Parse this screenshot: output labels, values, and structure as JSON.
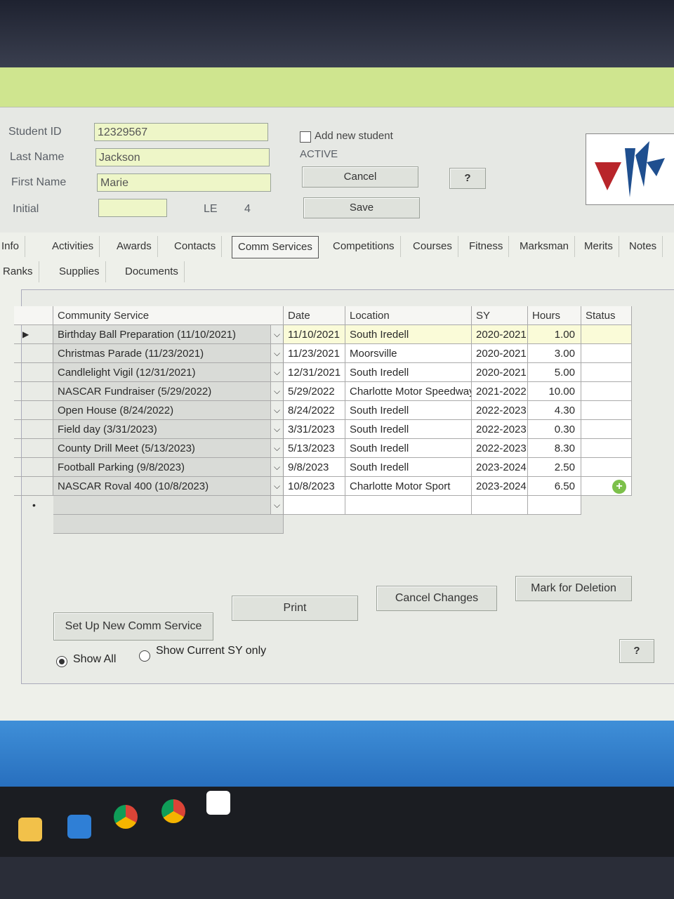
{
  "form": {
    "student_id_label": "Student ID",
    "student_id": "12329567",
    "last_name_label": "Last Name",
    "last_name": "Jackson",
    "first_name_label": "First Name",
    "first_name": "Marie",
    "initial_label": "Initial",
    "initial": "",
    "le_label": "LE",
    "le_value": "4",
    "add_new_label": "Add new student",
    "status": "ACTIVE",
    "cancel_label": "Cancel",
    "save_label": "Save",
    "help_label": "?"
  },
  "tabs_row1": [
    "Info",
    "Activities",
    "Awards",
    "Contacts",
    "Comm Services",
    "Competitions",
    "Courses",
    "Fitness",
    "Marksman",
    "Merits",
    "Notes"
  ],
  "tabs_row2": [
    "Ranks",
    "Supplies",
    "Documents"
  ],
  "active_tab": "Comm Services",
  "grid": {
    "headers": [
      "Community Service",
      "Date",
      "Location",
      "SY",
      "Hours",
      "Status"
    ],
    "rows": [
      {
        "service": "Birthday Ball Preparation  (11/10/2021)",
        "date": "11/10/2021",
        "location": "South Iredell",
        "sy": "2020-2021",
        "hours": "1.00",
        "status": ""
      },
      {
        "service": "Christmas Parade   (11/23/2021)",
        "date": "11/23/2021",
        "location": "Moorsville",
        "sy": "2020-2021",
        "hours": "3.00",
        "status": ""
      },
      {
        "service": "Candlelight Vigil  (12/31/2021)",
        "date": "12/31/2021",
        "location": "South Iredell",
        "sy": "2020-2021",
        "hours": "5.00",
        "status": ""
      },
      {
        "service": "NASCAR Fundraiser  (5/29/2022)",
        "date": "5/29/2022",
        "location": "Charlotte Motor Speedway",
        "sy": "2021-2022",
        "hours": "10.00",
        "status": ""
      },
      {
        "service": "Open House  (8/24/2022)",
        "date": "8/24/2022",
        "location": "South Iredell",
        "sy": "2022-2023",
        "hours": "4.30",
        "status": ""
      },
      {
        "service": "Field day  (3/31/2023)",
        "date": "3/31/2023",
        "location": "South Iredell",
        "sy": "2022-2023",
        "hours": "0.30",
        "status": ""
      },
      {
        "service": "County Drill Meet  (5/13/2023)",
        "date": "5/13/2023",
        "location": "South Iredell",
        "sy": "2022-2023",
        "hours": "8.30",
        "status": ""
      },
      {
        "service": "Football Parking  (9/8/2023)",
        "date": "9/8/2023",
        "location": "South Iredell",
        "sy": "2023-2024",
        "hours": "2.50",
        "status": ""
      },
      {
        "service": "NASCAR Roval 400  (10/8/2023)",
        "date": "10/8/2023",
        "location": "Charlotte Motor Sport",
        "sy": "2023-2024",
        "hours": "6.50",
        "status": ""
      }
    ]
  },
  "actions": {
    "setup_label": "Set Up New Comm Service",
    "print_label": "Print",
    "cancel_changes_label": "Cancel Changes",
    "mark_deletion_label": "Mark for Deletion",
    "show_all_label": "Show All",
    "show_current_label": "Show Current SY only",
    "help_label": "?"
  },
  "colors": {
    "title_bar": "#cfe58f",
    "field_bg": "#eef6c8",
    "selected_row": "#fafbd8",
    "desktop": "#2f78c6"
  },
  "taskbar_icons": [
    "file-explorer-icon",
    "mail-icon",
    "chrome-icon",
    "chrome-profile-icon",
    "app-logo-icon"
  ]
}
